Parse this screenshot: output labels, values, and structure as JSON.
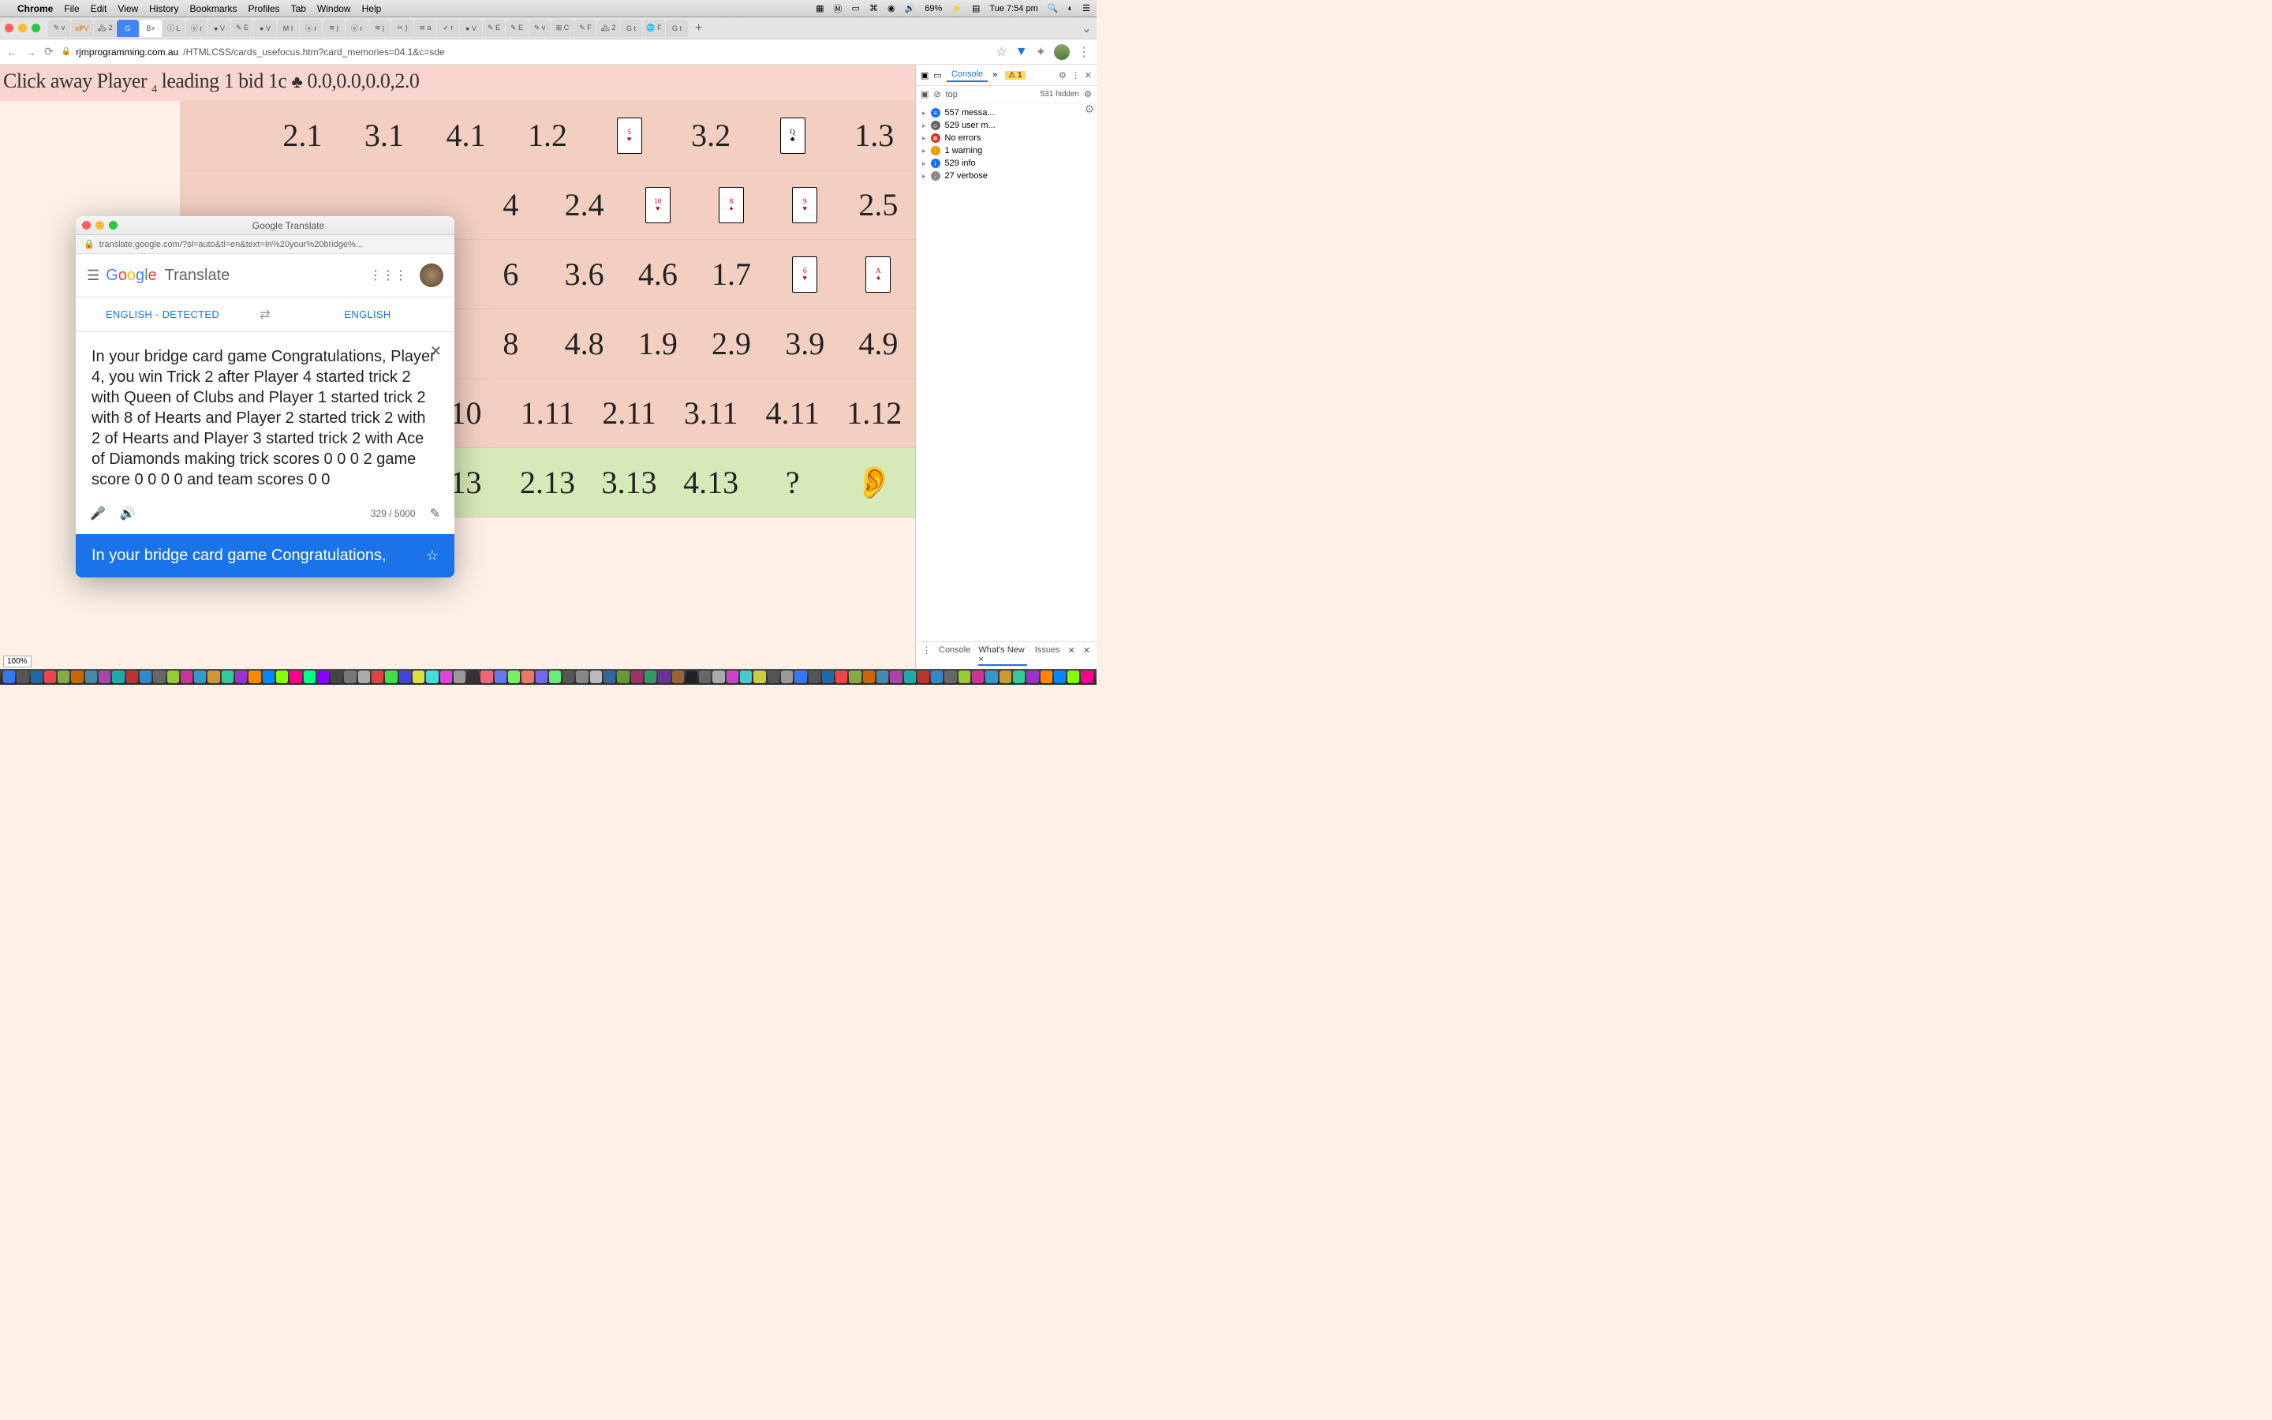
{
  "menubar": {
    "app": "Chrome",
    "items": [
      "File",
      "Edit",
      "View",
      "History",
      "Bookmarks",
      "Profiles",
      "Tab",
      "Window",
      "Help"
    ],
    "battery": "69%",
    "clock": "Tue 7:54 pm"
  },
  "tabs": {
    "active_label": "B",
    "plus": "+"
  },
  "url": {
    "host": "rjmprogramming.com.au",
    "path": "/HTMLCSS/cards_usefocus.htm?card_memories=04.1&c=sde"
  },
  "status": {
    "prefix": "Click away Player",
    "player_sub": "4",
    "middle": "leading 1 bid 1c",
    "scores": "0.0,0.0,0.0,2.0"
  },
  "grid": [
    [
      "",
      "2.1",
      "3.1",
      "4.1",
      "1.2",
      "CARD:♥5",
      "3.2",
      "CARD:♣Q",
      "1.3"
    ],
    [
      "",
      "",
      "",
      "",
      "4",
      "2.4",
      "CARD:♥10",
      "CARD:♦8",
      "CARD:♥9",
      "2.5"
    ],
    [
      "",
      "",
      "",
      "",
      "6",
      "3.6",
      "4.6",
      "1.7",
      "CARD:♥6",
      "CARD:♦A"
    ],
    [
      "",
      "",
      "",
      "",
      "8",
      "4.8",
      "1.9",
      "2.9",
      "3.9",
      "4.9"
    ],
    [
      "",
      "",
      "",
      "10",
      "1.11",
      "2.11",
      "3.11",
      "4.11",
      "1.12"
    ],
    [
      "",
      "",
      "",
      "13",
      "2.13",
      "3.13",
      "4.13",
      "?",
      "EAR"
    ]
  ],
  "translate": {
    "title": "Google Translate",
    "popup_url": "translate.google.com/?sl=auto&tl=en&text=In%20your%20bridge%...",
    "brand": "Translate",
    "lang_src": "ENGLISH - DETECTED",
    "lang_tgt": "ENGLISH",
    "body": "In your bridge card game Congratulations, Player 4, you win Trick 2  after Player 4 started trick 2 with Queen of Clubs and Player 1 started trick 2 with 8 of Hearts and Player 2 started trick 2 with 2 of Hearts and Player 3 started trick 2 with Ace of Diamonds making trick scores 0 0 0 2 game score 0 0 0 0 and team scores 0 0",
    "count": "329 / 5000",
    "output": "In your bridge card game Congratulations,"
  },
  "devtools": {
    "tab": "Console",
    "warn_badge": "1",
    "context": "top",
    "hidden": "531 hidden",
    "msgs": [
      {
        "icon": "blue",
        "text": "557 messa..."
      },
      {
        "icon": "user",
        "text": "529 user m..."
      },
      {
        "icon": "red",
        "text": "No errors"
      },
      {
        "icon": "warn",
        "text": "1 warning"
      },
      {
        "icon": "info",
        "text": "529 info"
      },
      {
        "icon": "verb",
        "text": "27 verbose"
      }
    ],
    "bottom": [
      "Console",
      "What's New ×",
      "Issues"
    ]
  },
  "zoom": "100%"
}
